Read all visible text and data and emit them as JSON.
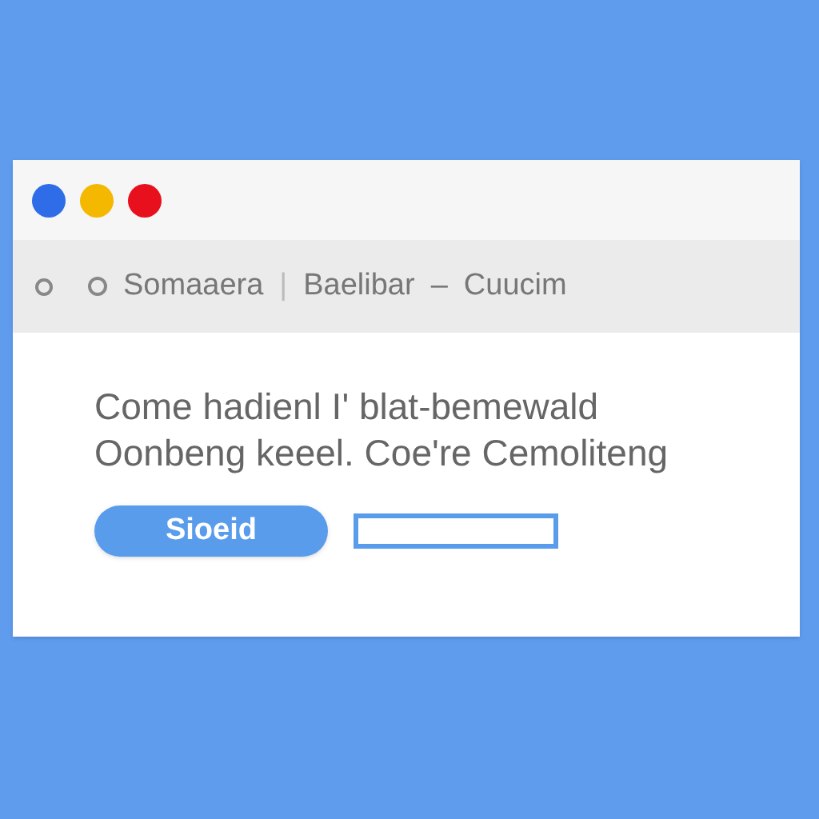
{
  "window": {
    "controls": [
      {
        "color": "#2f6de8"
      },
      {
        "color": "#f5b800"
      },
      {
        "color": "#e8101c"
      }
    ]
  },
  "address_bar": {
    "segments": [
      "Somaaera",
      "|",
      "Baelibar",
      "–",
      "Cuucim"
    ]
  },
  "content": {
    "heading_lines": [
      "Come hadienl I' blat‑bemewald",
      "Oonbeng keeel. Coe're Cemoliteng"
    ],
    "button": "Sioeid"
  }
}
